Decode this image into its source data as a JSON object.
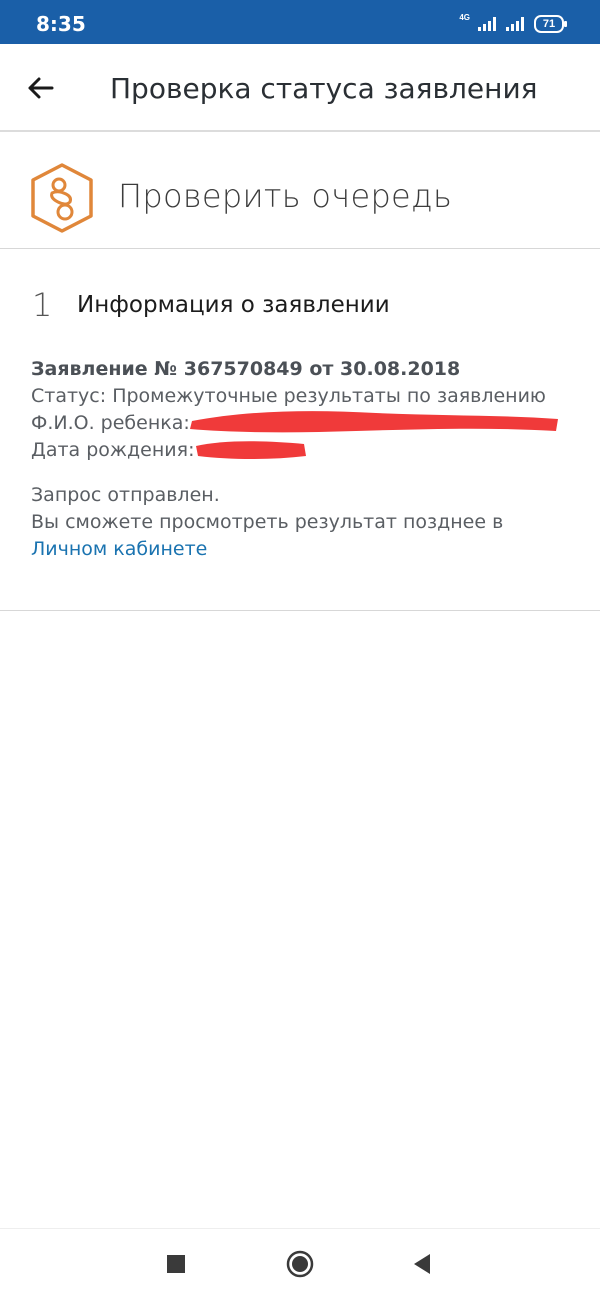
{
  "status_bar": {
    "time": "8:35",
    "network_label": "4G",
    "battery_level": "71"
  },
  "app_bar": {
    "back_icon": "arrow-left-icon",
    "title": "Проверка статуса заявления"
  },
  "service": {
    "icon": "pacifier-icon",
    "title": "Проверить очередь",
    "accent_color": "#e0873a"
  },
  "step": {
    "number": "1",
    "title": "Информация о заявлении"
  },
  "application": {
    "number_line": "Заявление № 367570849 от 30.08.2018",
    "status_label": "Статус:",
    "status_value": "Промежуточные результаты по заявлению",
    "child_name_label": "Ф.И.О. ребенка:",
    "birth_date_label": "Дата рождения:"
  },
  "notice": {
    "sent": "Запрос отправлен.",
    "message": "Вы сможете просмотреть результат позднее в",
    "link_label": "Личном кабинете",
    "link_color": "#1a73b0"
  },
  "colors": {
    "status_bar_bg": "#1a5fa8",
    "redaction": "#f03a3a"
  },
  "nav_bar": {
    "recent_icon": "square-icon",
    "home_icon": "circle-icon",
    "back_icon": "triangle-back-icon"
  }
}
